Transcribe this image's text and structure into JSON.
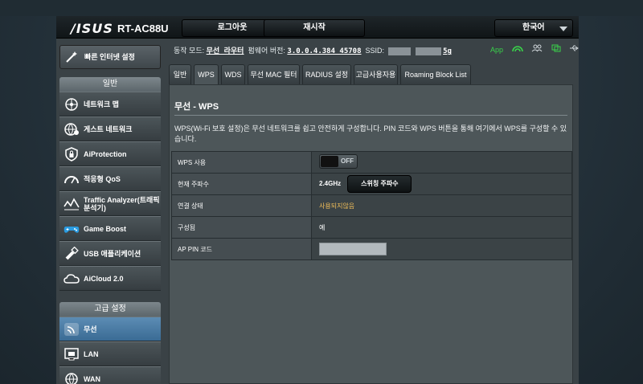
{
  "header": {
    "logo": "/ISUS",
    "model": "RT-AC88U",
    "logout_label": "로그아웃",
    "reboot_label": "재시작",
    "language_label": "한국어"
  },
  "status_bar": {
    "mode_label": "동작 모드:",
    "mode_value": "무선 라우터",
    "firmware_label": "펌웨어 버전:",
    "firmware_value": "3.0.0.4.384_45708",
    "ssid_label": "SSID:",
    "ssid_suffix": "5g",
    "app_label": "App"
  },
  "sidebar": {
    "quick_setup": "빠른 인터넷 설정",
    "general_header": "일반",
    "general_items": [
      {
        "label": "네트워크 맵",
        "icon": "network-map-icon"
      },
      {
        "label": "게스트 네트워크",
        "icon": "guest-network-icon"
      },
      {
        "label": "AiProtection",
        "icon": "shield-icon"
      },
      {
        "label": "적응형 QoS",
        "icon": "qos-gauge-icon"
      },
      {
        "label": "Traffic Analyzer(트래픽분석기)",
        "icon": "traffic-analyzer-icon"
      },
      {
        "label": "Game Boost",
        "icon": "gamepad-icon"
      },
      {
        "label": "USB 애플리케이션",
        "icon": "usb-icon"
      },
      {
        "label": "AiCloud 2.0",
        "icon": "cloud-icon"
      }
    ],
    "advanced_header": "고급 설정",
    "advanced_items": [
      {
        "label": "무선",
        "icon": "wireless-icon",
        "active": true
      },
      {
        "label": "LAN",
        "icon": "lan-icon"
      },
      {
        "label": "WAN",
        "icon": "wan-globe-icon"
      }
    ]
  },
  "tabs": [
    {
      "label": "일반"
    },
    {
      "label": "WPS",
      "active": true
    },
    {
      "label": "WDS"
    },
    {
      "label": "무선 MAC 필터"
    },
    {
      "label": "RADIUS 설정"
    },
    {
      "label": "고급사용자용"
    },
    {
      "label": "Roaming Block List"
    }
  ],
  "content": {
    "title": "무선 - WPS",
    "description": "WPS(Wi-Fi 보호 설정)은 무선 네트워크를 쉽고 안전하게 구성합니다. PIN 코드와 WPS 버튼을 통해 여기에서 WPS를 구성할 수 있습니다.",
    "rows": {
      "wps_enable_label": "WPS 사용",
      "wps_enable_state": "OFF",
      "frequency_label": "현재 주파수",
      "frequency_value": "2.4GHz",
      "switch_frequency_label": "스위칭 주파수",
      "connection_label": "연결 상태",
      "connection_value": "사용되지않음",
      "configured_label": "구성됨",
      "configured_value": "예",
      "ap_pin_label": "AP PIN 코드",
      "ap_pin_value": ""
    }
  },
  "colors": {
    "accent_active": "#4a7ba4",
    "status_green": "#39d24a",
    "state_warning": "#f5c15a"
  }
}
